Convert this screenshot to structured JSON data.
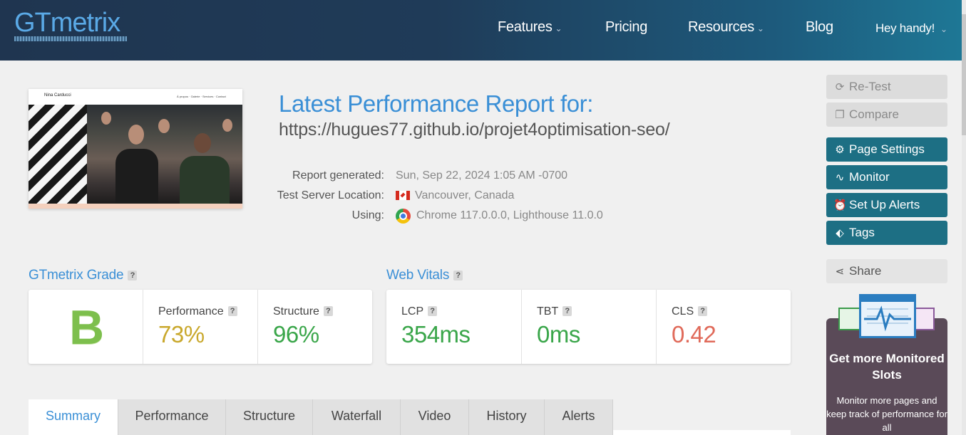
{
  "header": {
    "logo": "GTmetrix",
    "nav": [
      {
        "label": "Features",
        "has_dropdown": true
      },
      {
        "label": "Pricing",
        "has_dropdown": false
      },
      {
        "label": "Resources",
        "has_dropdown": true
      },
      {
        "label": "Blog",
        "has_dropdown": false
      }
    ],
    "user": "Hey handy!"
  },
  "thumbnail": {
    "site_name": "Nina Carducci",
    "site_nav": "À propos · Galerie · Services · Contact"
  },
  "report": {
    "title": "Latest Performance Report for:",
    "url": "https://hugues77.github.io/projet4optimisation-seo/",
    "meta": [
      {
        "label": "Report generated:",
        "value": "Sun, Sep 22, 2024 1:05 AM -0700"
      },
      {
        "label": "Test Server Location:",
        "value": "Vancouver, Canada",
        "icon": "canada-flag-icon"
      },
      {
        "label": "Using:",
        "value": "Chrome 117.0.0.0, Lighthouse 11.0.0",
        "icon": "chrome-icon"
      }
    ]
  },
  "sidebar": {
    "buttons": [
      {
        "label": "Re-Test",
        "icon": "refresh-icon",
        "style": "disabled"
      },
      {
        "label": "Compare",
        "icon": "copy-icon",
        "style": "disabled"
      },
      {
        "label": "Page Settings",
        "icon": "gear-icon",
        "style": "primary"
      },
      {
        "label": "Monitor",
        "icon": "pulse-icon",
        "style": "primary"
      },
      {
        "label": "Set Up Alerts",
        "icon": "alarm-icon",
        "style": "primary"
      },
      {
        "label": "Tags",
        "icon": "tag-icon",
        "style": "primary"
      }
    ],
    "share": {
      "label": "Share",
      "icon": "share-icon"
    },
    "promo": {
      "title": "Get more Monitored Slots",
      "text": "Monitor more pages and keep track of performance for all"
    }
  },
  "grade": {
    "heading": "GTmetrix Grade",
    "help": "?",
    "letter": "B",
    "performance_label": "Performance",
    "performance_value": "73%",
    "structure_label": "Structure",
    "structure_value": "96%"
  },
  "vitals": {
    "heading": "Web Vitals",
    "help": "?",
    "lcp_label": "LCP",
    "lcp_value": "354ms",
    "tbt_label": "TBT",
    "tbt_value": "0ms",
    "cls_label": "CLS",
    "cls_value": "0.42"
  },
  "colors": {
    "brand_blue": "#3a8fd6",
    "teal_button": "#1d6f84",
    "performance": "#c9a82c",
    "good": "#3aa64a",
    "bad": "#e06a5a"
  },
  "tabs": [
    "Summary",
    "Performance",
    "Structure",
    "Waterfall",
    "Video",
    "History",
    "Alerts"
  ],
  "active_tab": "Summary"
}
